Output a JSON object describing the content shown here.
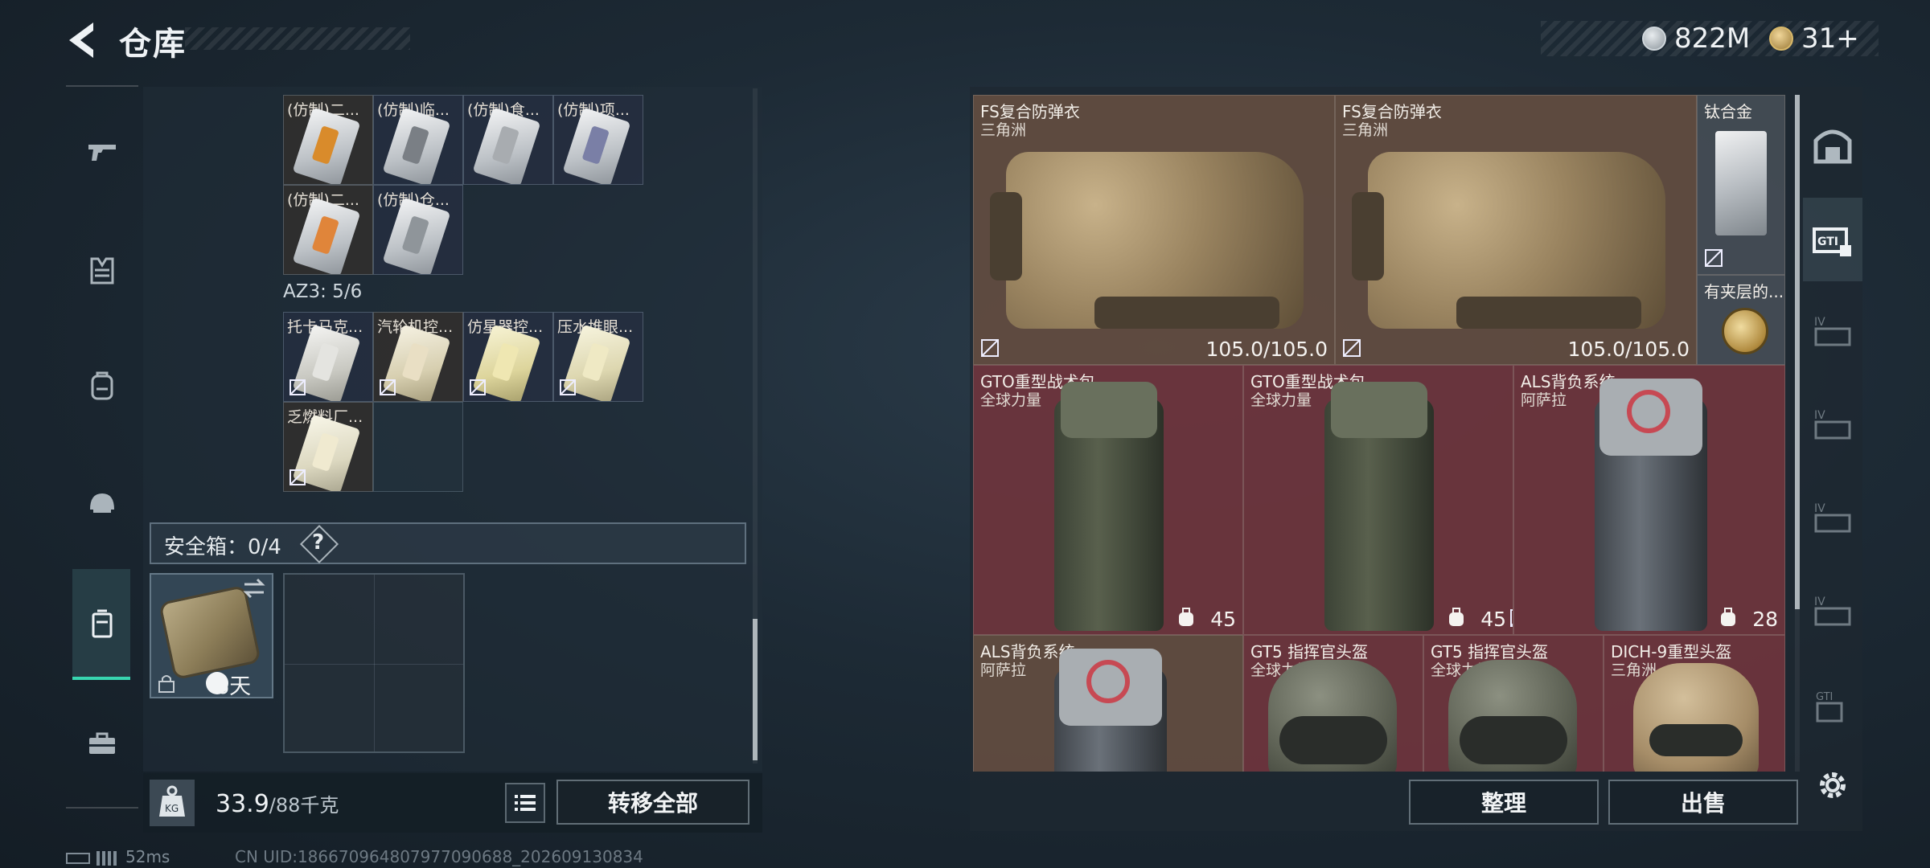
{
  "header": {
    "title": "仓库",
    "currency_silver": "822M",
    "currency_gold": "31+"
  },
  "left_panel": {
    "group1_items": [
      {
        "label": "(仿制)二...",
        "tone": "brown",
        "color": "#d98b2b"
      },
      {
        "label": "(仿制)临...",
        "tone": "dark",
        "color": "#7a7f85"
      },
      {
        "label": "(仿制)食...",
        "tone": "dark",
        "color": "#a8acb0"
      },
      {
        "label": "(仿制)项...",
        "tone": "dark",
        "color": "#7a7fa6"
      },
      {
        "label": "(仿制)二...",
        "tone": "brown",
        "color": "#e0853a"
      },
      {
        "label": "(仿制)仓...",
        "tone": "dark",
        "color": "#8f959a"
      }
    ],
    "az3_label": "AZ3: 5/6",
    "az3_items": [
      {
        "label": "托卡马克...",
        "tone": "dark",
        "color": "#e4e4e0"
      },
      {
        "label": "汽轮机控...",
        "tone": "brown",
        "color": "#e9dfc4"
      },
      {
        "label": "仿星器控...",
        "tone": "dark",
        "color": "#efe7b2"
      },
      {
        "label": "压水堆眼...",
        "tone": "dark",
        "color": "#efe9c4"
      },
      {
        "label": "乏燃料厂...",
        "tone": "brown",
        "color": "#f0ead0"
      }
    ],
    "safebox_label": "安全箱：0/4",
    "help_label": "?",
    "safebox_days": "6天",
    "weight_current": "33.9",
    "weight_max": "/88千克",
    "transfer_all": "转移全部"
  },
  "status": {
    "ping": "52ms",
    "uid": "CN UID:18667096480797709068​8_202609130834"
  },
  "right_panel": {
    "items": [
      {
        "name": "FS复合防弹衣",
        "sub": "三角洲",
        "durability": "105.0/105.0"
      },
      {
        "name": "FS复合防弹衣",
        "sub": "三角洲",
        "durability": "105.0/105.0"
      },
      {
        "name": "钛合金",
        "sub": ""
      },
      {
        "name": "有夹层的...",
        "sub": ""
      },
      {
        "name": "GTO重型战术包",
        "sub": "全球力量",
        "count": "45"
      },
      {
        "name": "GTO重型战术包",
        "sub": "全球力量",
        "count": "45"
      },
      {
        "name": "ALS背负系统",
        "sub": "阿萨拉",
        "count": "28"
      },
      {
        "name": "ALS背负系统",
        "sub": "阿萨拉"
      },
      {
        "name": "GT5 指挥官头盔",
        "sub": "全球力量"
      },
      {
        "name": "GT5 指挥官头盔",
        "sub": "全球力量"
      },
      {
        "name": "DICH-9重型头盔",
        "sub": "三角洲"
      }
    ],
    "sort_button": "整理",
    "sell_button": "出售"
  }
}
